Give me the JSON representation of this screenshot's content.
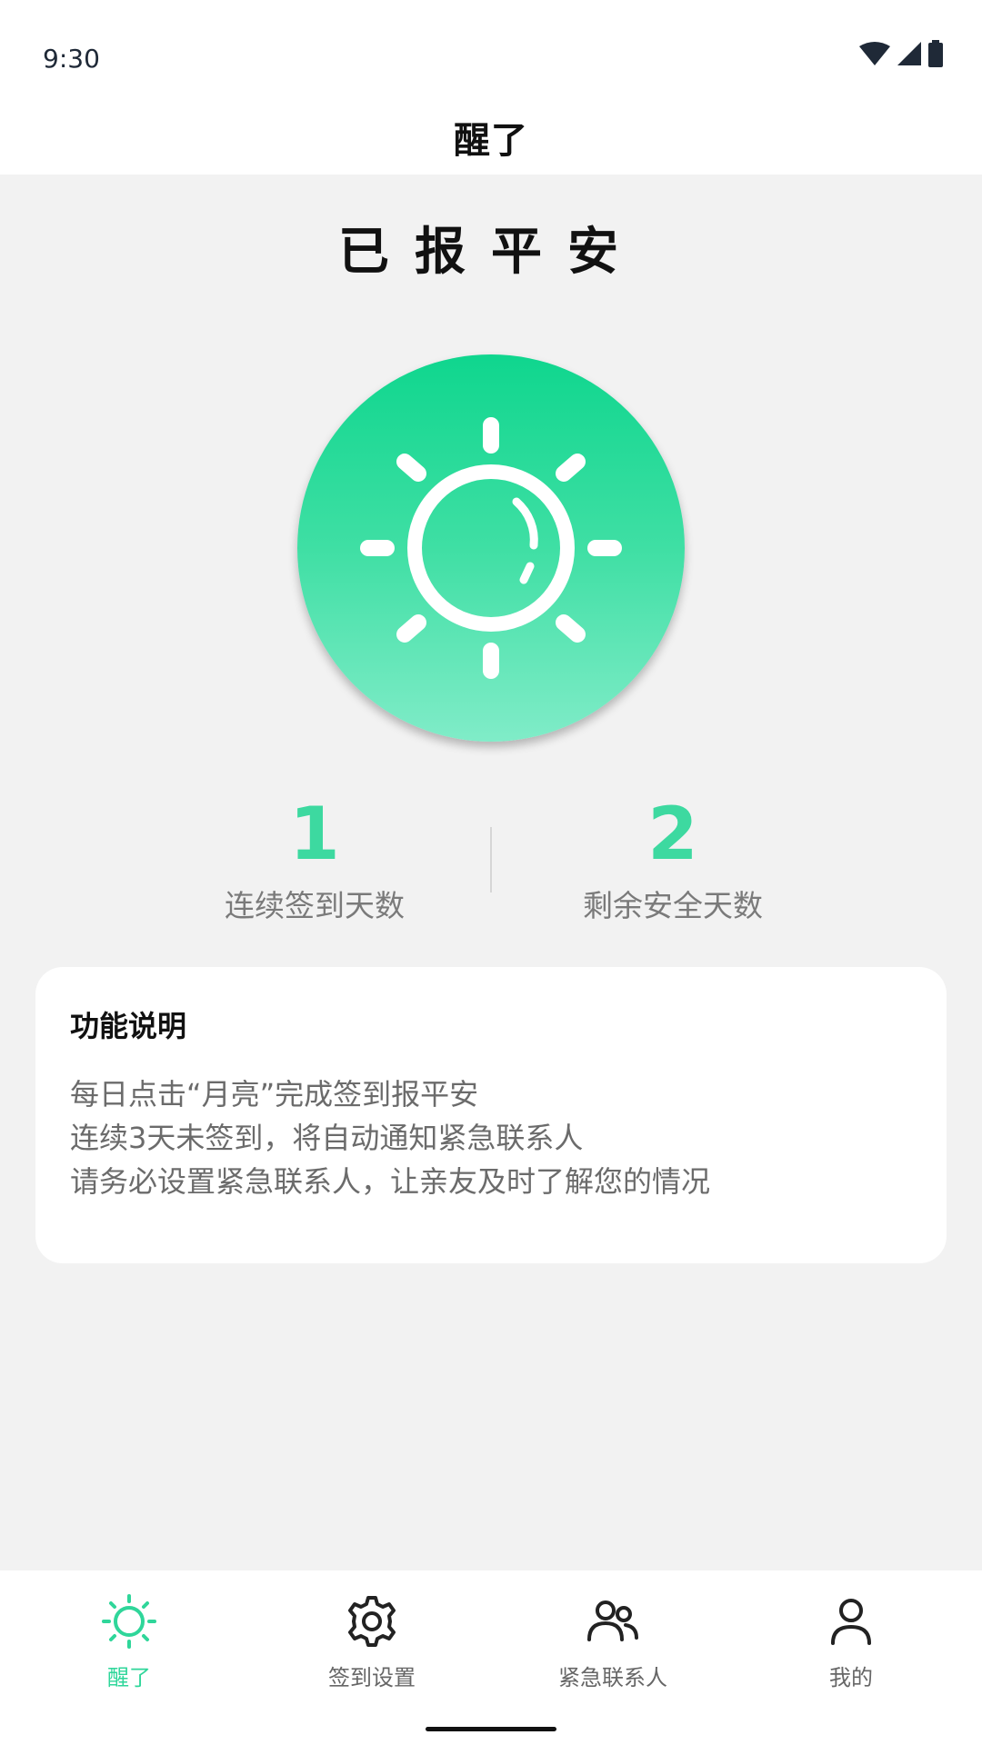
{
  "status_bar": {
    "time": "9:30"
  },
  "app_bar": {
    "title": "醒了"
  },
  "main": {
    "headline": "已报平安",
    "checkin_icon": "sun-icon",
    "stats": [
      {
        "value": "1",
        "label": "连续签到天数"
      },
      {
        "value": "2",
        "label": "剩余安全天数"
      }
    ]
  },
  "info_card": {
    "title": "功能说明",
    "lines": [
      "每日点击“月亮”完成签到报平安",
      "连续3天未签到，将自动通知紧急联系人",
      "请务必设置紧急联系人，让亲友及时了解您的情况"
    ]
  },
  "bottom_nav": {
    "items": [
      {
        "label": "醒了",
        "icon": "sun-icon",
        "active": true
      },
      {
        "label": "签到设置",
        "icon": "gear-icon",
        "active": false
      },
      {
        "label": "紧急联系人",
        "icon": "contacts-icon",
        "active": false
      },
      {
        "label": "我的",
        "icon": "person-icon",
        "active": false
      }
    ]
  },
  "colors": {
    "accent": "#3dd9a0",
    "active_tab": "#2fd69a",
    "background": "#f2f2f2"
  }
}
